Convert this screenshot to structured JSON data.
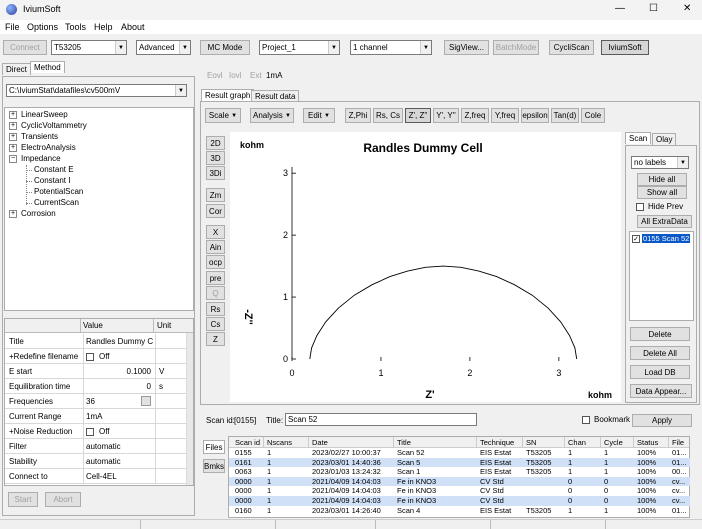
{
  "window": {
    "title": "IviumSoft",
    "min": "—",
    "max": "☐",
    "close": "✕"
  },
  "menu": [
    "File",
    "Options",
    "Tools",
    "Help",
    "About"
  ],
  "toolbar": {
    "connect": "Connect",
    "device": "T53205",
    "mode": "Advanced",
    "mc_mode": "MC Mode",
    "project": "Project_1",
    "channel": "1 channel",
    "sigview": "SigView...",
    "batchmode": "BatchMode",
    "cycliscan": "CycliScan",
    "iviumsoft": "IviumSoft"
  },
  "left_tabs": [
    "Direct",
    "Method"
  ],
  "method_path": "C:\\IviumStat\\datafiles\\cv500mV",
  "tree": [
    {
      "label": "LinearSweep",
      "type": "plus"
    },
    {
      "label": "CyclicVoltammetry",
      "type": "plus"
    },
    {
      "label": "Transients",
      "type": "plus"
    },
    {
      "label": "ElectroAnalysis",
      "type": "plus"
    },
    {
      "label": "Impedance",
      "type": "minus"
    },
    {
      "label": "Constant E",
      "type": "child"
    },
    {
      "label": "Constant I",
      "type": "child"
    },
    {
      "label": "PotentialScan",
      "type": "child"
    },
    {
      "label": "CurrentScan",
      "type": "child"
    },
    {
      "label": "Corrosion",
      "type": "plus"
    }
  ],
  "grid": {
    "headers": [
      "",
      "Value",
      "Unit"
    ],
    "rows": [
      {
        "label": "Title",
        "value": "Randles Dummy Cell",
        "unit": "",
        "align": "l"
      },
      {
        "label": "+Redefine filename",
        "value": "Off",
        "unit": "",
        "align": "l",
        "checkbox": true
      },
      {
        "label": "E start",
        "value": "0.1000",
        "unit": "V",
        "align": "r"
      },
      {
        "label": "Equilibration time",
        "value": "0",
        "unit": "s",
        "align": "r"
      },
      {
        "label": "Frequencies",
        "value": "36",
        "unit": "",
        "align": "l",
        "slider": true
      },
      {
        "label": "Current Range",
        "value": "1mA",
        "unit": "",
        "align": "l"
      },
      {
        "label": "+Noise Reduction",
        "value": "Off",
        "unit": "",
        "align": "l",
        "checkbox": true
      },
      {
        "label": "Filter",
        "value": "automatic",
        "unit": "",
        "align": "l"
      },
      {
        "label": "Stability",
        "value": "automatic",
        "unit": "",
        "align": "l"
      },
      {
        "label": "Connect to",
        "value": "Cell-4EL",
        "unit": "",
        "align": "l"
      }
    ]
  },
  "start": "Start",
  "abort": "Abort",
  "readouts": [
    "Eovl",
    "Iovl",
    "Ext",
    "1mA"
  ],
  "result_tabs": [
    "Result graph",
    "Result data"
  ],
  "graph_toolbar": [
    "Scale",
    "Analysis",
    "Edit",
    "Z,Phi",
    "Rs, Cs",
    "Z', Z''",
    "Y', Y''",
    "Z,freq",
    "Y,freq",
    "epsilon",
    "Tan(d)",
    "Cole"
  ],
  "view_buttons": [
    "2D",
    "3D",
    "3Di",
    "Zm",
    "Cor",
    "X",
    "Ain",
    "ocp",
    "pre",
    "Q",
    "Rs",
    "Cs",
    "Z"
  ],
  "right_tabs": [
    "Scan",
    "Olay"
  ],
  "labels_select": "no labels",
  "hide_all": "Hide all",
  "show_all": "Show all",
  "hide_prev": "Hide Prev",
  "all_extradata": "All ExtraData",
  "scan_list": [
    {
      "label": "0155 Scan 52",
      "checked": true
    }
  ],
  "delete": "Delete",
  "delete_all": "Delete All",
  "load_db": "Load DB",
  "data_appear": "Data Appear...",
  "chart_data": {
    "type": "scatter",
    "title": "Randles Dummy Cell",
    "xlabel": "Z'",
    "ylabel": "-Z''",
    "x_unit": "kohm",
    "y_unit": "kohm",
    "xlim": [
      0,
      3.35
    ],
    "ylim": [
      0,
      3.1
    ],
    "xticks": [
      0,
      1,
      2,
      3
    ],
    "yticks": [
      0,
      1,
      2,
      3
    ],
    "x": [
      0.2,
      0.22,
      0.28,
      0.38,
      0.52,
      0.7,
      0.9,
      1.1,
      1.3,
      1.5,
      1.7,
      1.9,
      2.1,
      2.3,
      2.5,
      2.7,
      2.88,
      3.02,
      3.12,
      3.18,
      3.2
    ],
    "y": [
      0.0,
      0.18,
      0.38,
      0.6,
      0.82,
      1.03,
      1.2,
      1.33,
      1.42,
      1.48,
      1.5,
      1.48,
      1.42,
      1.33,
      1.2,
      1.03,
      0.82,
      0.6,
      0.38,
      0.18,
      0.0
    ],
    "grid": false
  },
  "scan_info": {
    "scan_id_label": "Scan id:",
    "scan_id": "[0155]",
    "title_label": "Title:",
    "title": "Scan 52",
    "bookmark": "Bookmark",
    "apply": "Apply"
  },
  "side_tabs": [
    "Files",
    "Bmks"
  ],
  "table": {
    "columns": [
      "Scan id",
      "Nscans",
      "Date",
      "Title",
      "Technique",
      "SN",
      "Chan",
      "Cycle",
      "Status",
      "File"
    ],
    "rows": [
      [
        "0155",
        "1",
        "2023/02/27 10:00:37",
        "Scan 52",
        "EIS Estat",
        "T53205",
        "1",
        "1",
        "100%",
        "01..."
      ],
      [
        "0161",
        "1",
        "2023/03/01 14:40:36",
        "Scan 5",
        "EIS Estat",
        "T53205",
        "1",
        "1",
        "100%",
        "01..."
      ],
      [
        "0063",
        "1",
        "2023/01/03 13:24:32",
        "Scan 1",
        "EIS Estat",
        "T53205",
        "1",
        "1",
        "100%",
        "00..."
      ],
      [
        "0000",
        "1",
        "2021/04/09 14:04:03",
        "Fe in KNO3",
        "CV Std",
        "",
        "0",
        "0",
        "100%",
        "cv..."
      ],
      [
        "0000",
        "1",
        "2021/04/09 14:04:03",
        "Fe in KNO3",
        "CV Std",
        "",
        "0",
        "0",
        "100%",
        "cv..."
      ],
      [
        "0000",
        "1",
        "2021/04/09 14:04:03",
        "Fe in KNO3",
        "CV Std",
        "",
        "0",
        "0",
        "100%",
        "cv..."
      ],
      [
        "0160",
        "1",
        "2023/03/01 14:26:40",
        "Scan 4",
        "EIS Estat",
        "T53205",
        "1",
        "1",
        "100%",
        "01..."
      ]
    ]
  }
}
